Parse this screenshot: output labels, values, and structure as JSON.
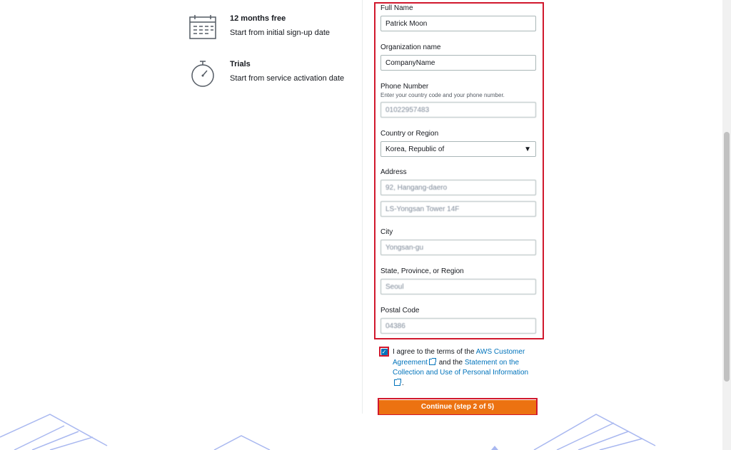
{
  "info": [
    {
      "title": "12 months free",
      "subtitle": "Start from initial sign-up date",
      "icon": "calendar-icon"
    },
    {
      "title": "Trials",
      "subtitle": "Start from service activation date",
      "icon": "stopwatch-icon"
    }
  ],
  "form": {
    "full_name": {
      "label": "Full Name",
      "value": "Patrick Moon"
    },
    "organization": {
      "label": "Organization name",
      "value": "CompanyName"
    },
    "phone": {
      "label": "Phone Number",
      "help": "Enter your country code and your phone number.",
      "value": "01022957483"
    },
    "country": {
      "label": "Country or Region",
      "value": "Korea, Republic of"
    },
    "address": {
      "label": "Address",
      "line1": "92, Hangang-daero",
      "line2": "LS-Yongsan Tower 14F"
    },
    "city": {
      "label": "City",
      "value": "Yongsan-gu"
    },
    "state": {
      "label": "State, Province, or Region",
      "value": "Seoul"
    },
    "postal": {
      "label": "Postal Code",
      "value": "04386"
    }
  },
  "agreement": {
    "prefix": "I agree to the terms of the",
    "link1": "AWS Customer Agreement",
    "middle": "and the",
    "link2": "Statement on the Collection and Use of Personal Information",
    "suffix": "."
  },
  "continue_label": "Continue (step 2 of 5)",
  "colors": {
    "accent": "#ec7211",
    "highlight": "#d1182d",
    "link": "#0073bb"
  }
}
